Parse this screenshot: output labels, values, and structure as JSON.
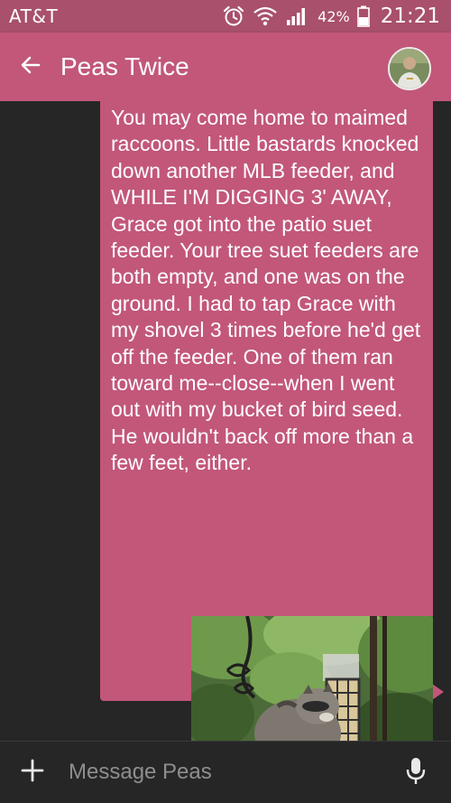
{
  "status_bar": {
    "carrier": "AT&T",
    "battery_percent": "42%",
    "time": "21:21",
    "icons": [
      "alarm-icon",
      "wifi-icon",
      "signal-icon",
      "battery-icon"
    ]
  },
  "app_bar": {
    "contact_name": "Peas Twice",
    "back_icon": "arrow-left-icon",
    "avatar": "contact-avatar"
  },
  "conversation": {
    "messages": [
      {
        "direction": "outgoing",
        "text": "You may come home to maimed raccoons. Little bastards knocked down another MLB feeder, and WHILE I'M DIGGING 3' AWAY, Grace got into the patio suet feeder. Your tree suet feeders are both empty, and one was on the ground. I had to tap Grace with my shovel 3 times before he'd get off the feeder. One of them ran toward me--close--when I went out with my bucket of bird seed. He wouldn't back off more than a few feet, either."
      },
      {
        "direction": "outgoing",
        "type": "image",
        "subject": "raccoon-on-bird-feeder-photo"
      }
    ]
  },
  "composer": {
    "placeholder": "Message Peas",
    "value": "",
    "attach_icon": "plus-icon",
    "voice_icon": "microphone-icon"
  },
  "colors": {
    "status_bar": "#a8506c",
    "app_bar": "#c2577a",
    "bubble": "#c2577a",
    "background": "#262626",
    "text": "#ffffff",
    "placeholder": "#8e8e8e"
  }
}
